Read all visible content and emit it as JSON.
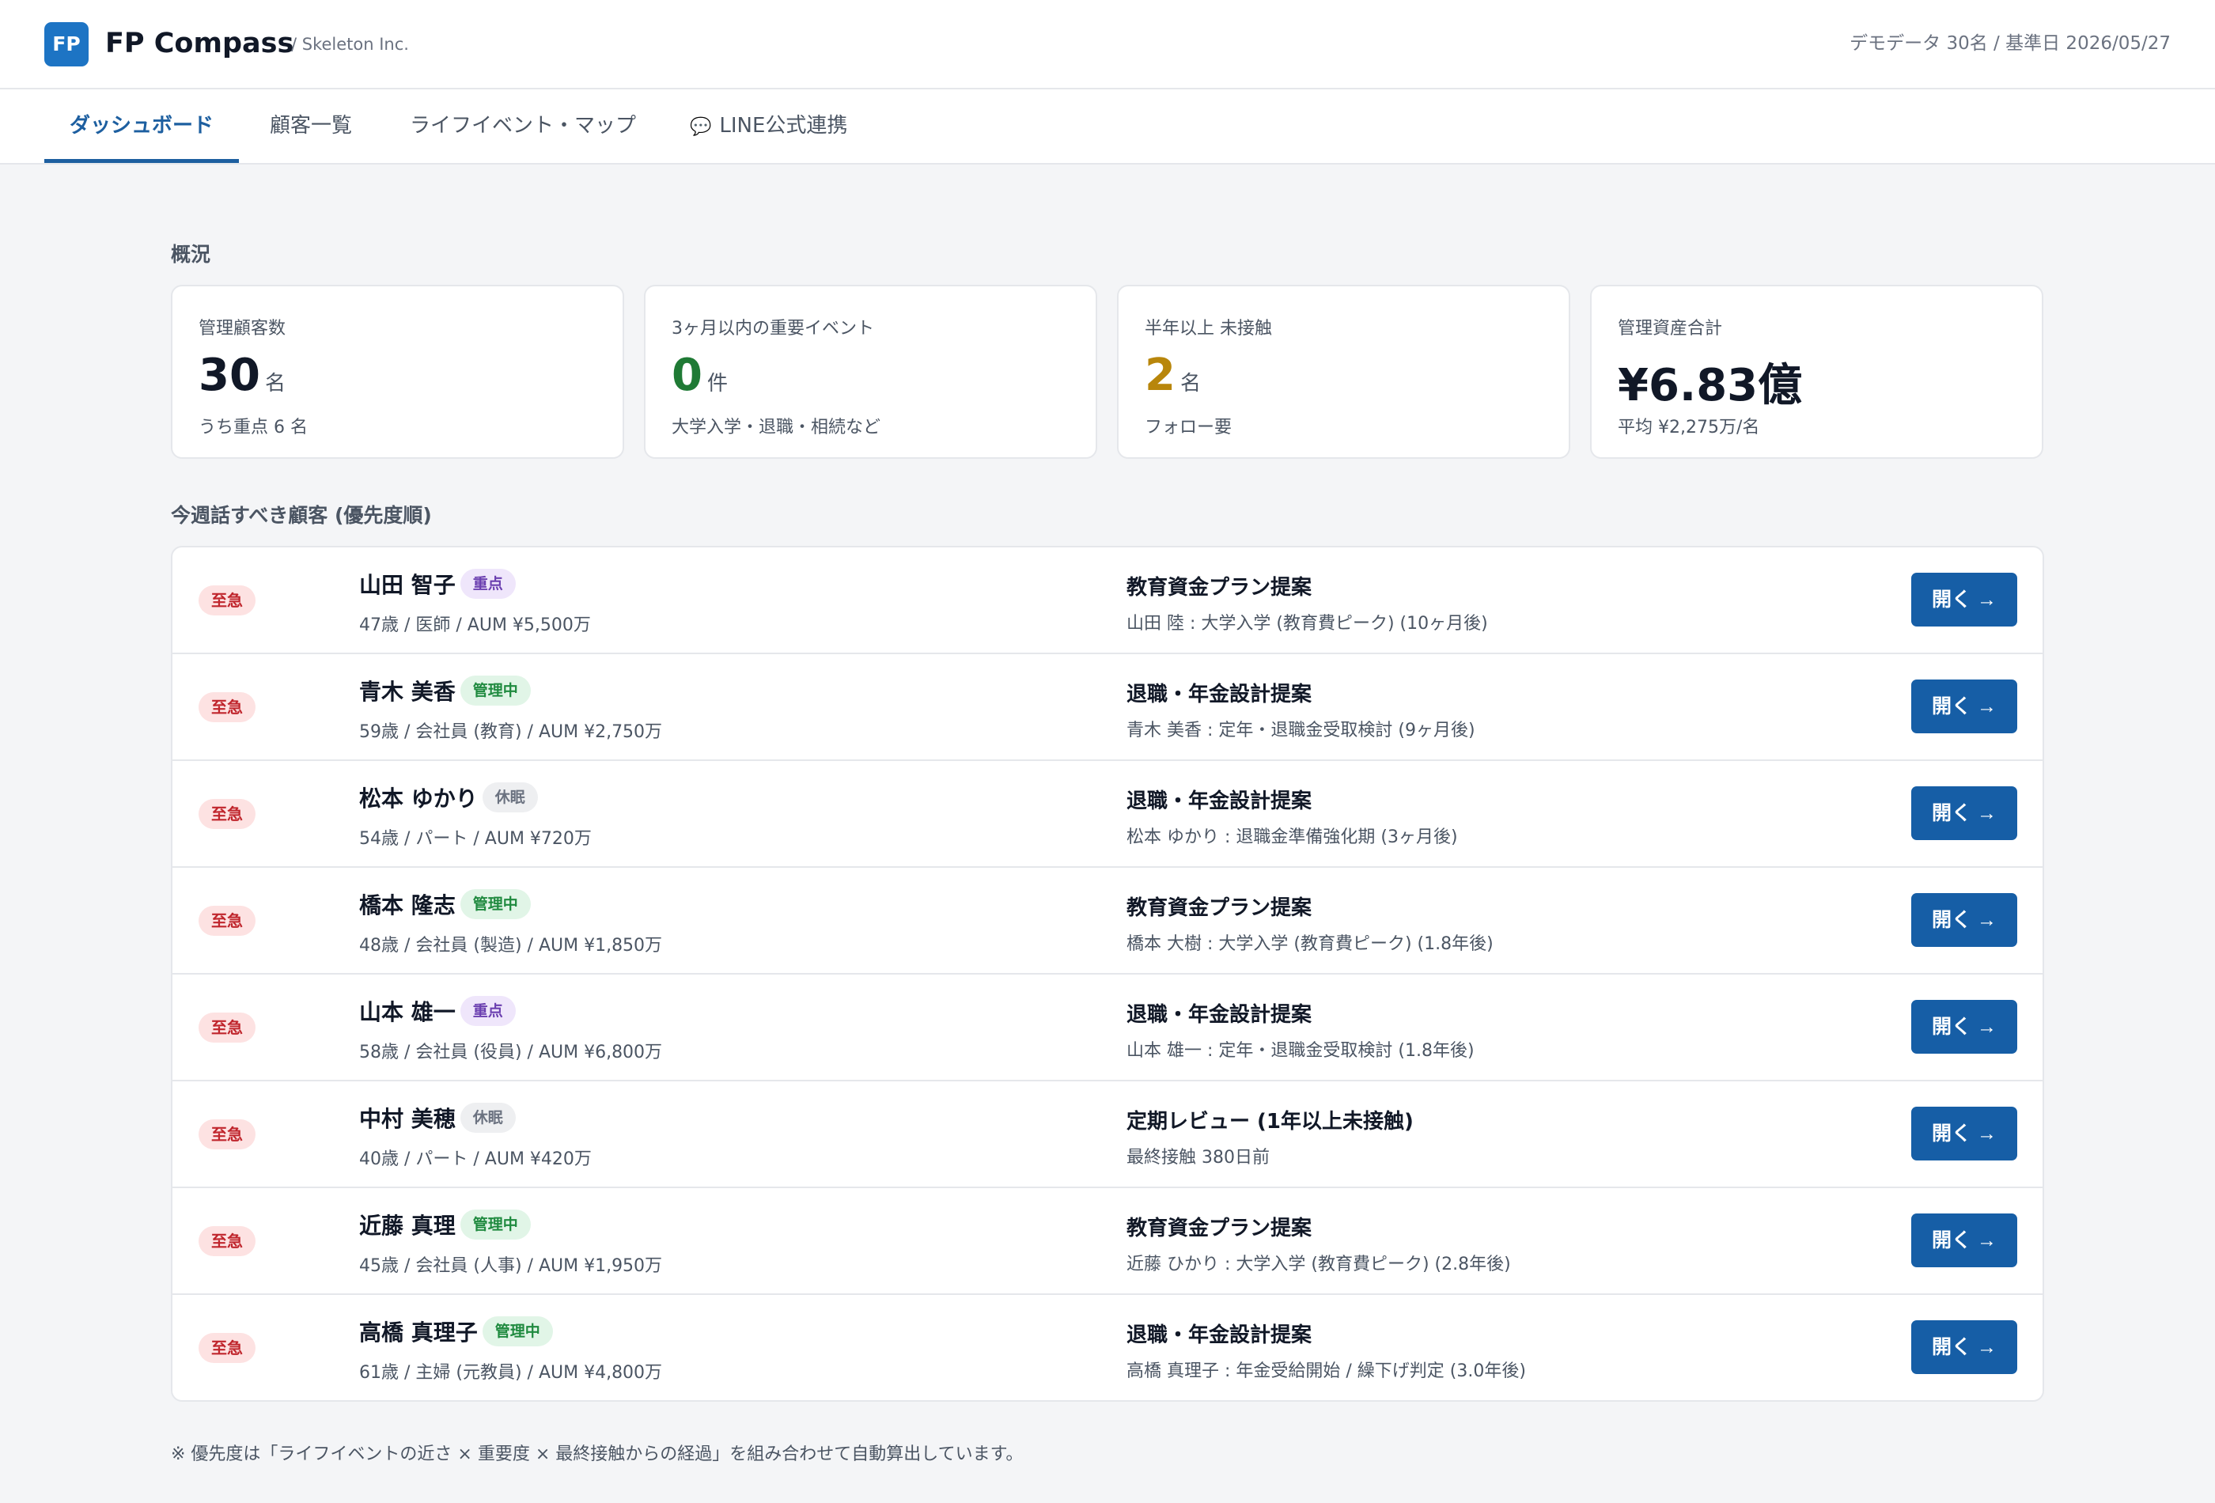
{
  "header": {
    "logo_text": "FP",
    "app_name": "FP Compass",
    "org": "/ Skeleton Inc.",
    "demo_info": "デモデータ 30名 / 基準日 2026/05/27"
  },
  "tabs": [
    {
      "label": "ダッシュボード",
      "active": true
    },
    {
      "label": "顧客一覧"
    },
    {
      "label": "ライフイベント・マップ"
    },
    {
      "label": "LINE公式連携",
      "icon": "chat-bubble-icon"
    }
  ],
  "overview": {
    "label": "概況",
    "cards": [
      {
        "title": "管理顧客数",
        "value": "30",
        "unit": "名",
        "sub": "うち重点 6 名",
        "color": "#111827"
      },
      {
        "title": "3ヶ月以内の重要イベント",
        "value": "0",
        "unit": "件",
        "sub": "大学入学・退職・相続など",
        "color": "#1f7a35"
      },
      {
        "title": "半年以上 未接触",
        "value": "2",
        "unit": "名",
        "sub": "フォロー要",
        "color": "#b8860b"
      },
      {
        "title": "管理資産合計",
        "value": "¥6.83億",
        "unit": "",
        "sub": "平均 ¥2,275万/名",
        "color": "#111827"
      }
    ]
  },
  "priority": {
    "label": "今週話すべき顧客 (優先度順)",
    "open_label": "開く →",
    "rows": [
      {
        "badge": "至急",
        "name": "山田 智子",
        "tag": "重点",
        "tag_type": "key",
        "meta": "47歳 / 医師 / AUM ¥5,500万",
        "action": "教育資金プラン提案",
        "detail": "山田 陸 : 大学入学 (教育費ピーク) (10ヶ月後)"
      },
      {
        "badge": "至急",
        "name": "青木 美香",
        "tag": "管理中",
        "tag_type": "managed",
        "meta": "59歳 / 会社員 (教育) / AUM ¥2,750万",
        "action": "退職・年金設計提案",
        "detail": "青木 美香 : 定年・退職金受取検討 (9ヶ月後)"
      },
      {
        "badge": "至急",
        "name": "松本 ゆかり",
        "tag": "休眠",
        "tag_type": "dormant",
        "meta": "54歳 / パート / AUM ¥720万",
        "action": "退職・年金設計提案",
        "detail": "松本 ゆかり : 退職金準備強化期 (3ヶ月後)"
      },
      {
        "badge": "至急",
        "name": "橋本 隆志",
        "tag": "管理中",
        "tag_type": "managed",
        "meta": "48歳 / 会社員 (製造) / AUM ¥1,850万",
        "action": "教育資金プラン提案",
        "detail": "橋本 大樹 : 大学入学 (教育費ピーク) (1.8年後)"
      },
      {
        "badge": "至急",
        "name": "山本 雄一",
        "tag": "重点",
        "tag_type": "key",
        "meta": "58歳 / 会社員 (役員) / AUM ¥6,800万",
        "action": "退職・年金設計提案",
        "detail": "山本 雄一 : 定年・退職金受取検討 (1.8年後)"
      },
      {
        "badge": "至急",
        "name": "中村 美穂",
        "tag": "休眠",
        "tag_type": "dormant",
        "meta": "40歳 / パート / AUM ¥420万",
        "action": "定期レビュー (1年以上未接触)",
        "detail": "最終接触 380日前"
      },
      {
        "badge": "至急",
        "name": "近藤 真理",
        "tag": "管理中",
        "tag_type": "managed",
        "meta": "45歳 / 会社員 (人事) / AUM ¥1,950万",
        "action": "教育資金プラン提案",
        "detail": "近藤 ひかり : 大学入学 (教育費ピーク) (2.8年後)"
      },
      {
        "badge": "至急",
        "name": "高橋 真理子",
        "tag": "管理中",
        "tag_type": "managed",
        "meta": "61歳 / 主婦 (元教員) / AUM ¥4,800万",
        "action": "退職・年金設計提案",
        "detail": "高橋 真理子 : 年金受給開始 / 繰下げ判定 (3.0年後)"
      }
    ]
  },
  "footnote": "※ 優先度は「ライフイベントの近さ × 重要度 × 最終接触からの経過」を組み合わせて自動算出しています。"
}
